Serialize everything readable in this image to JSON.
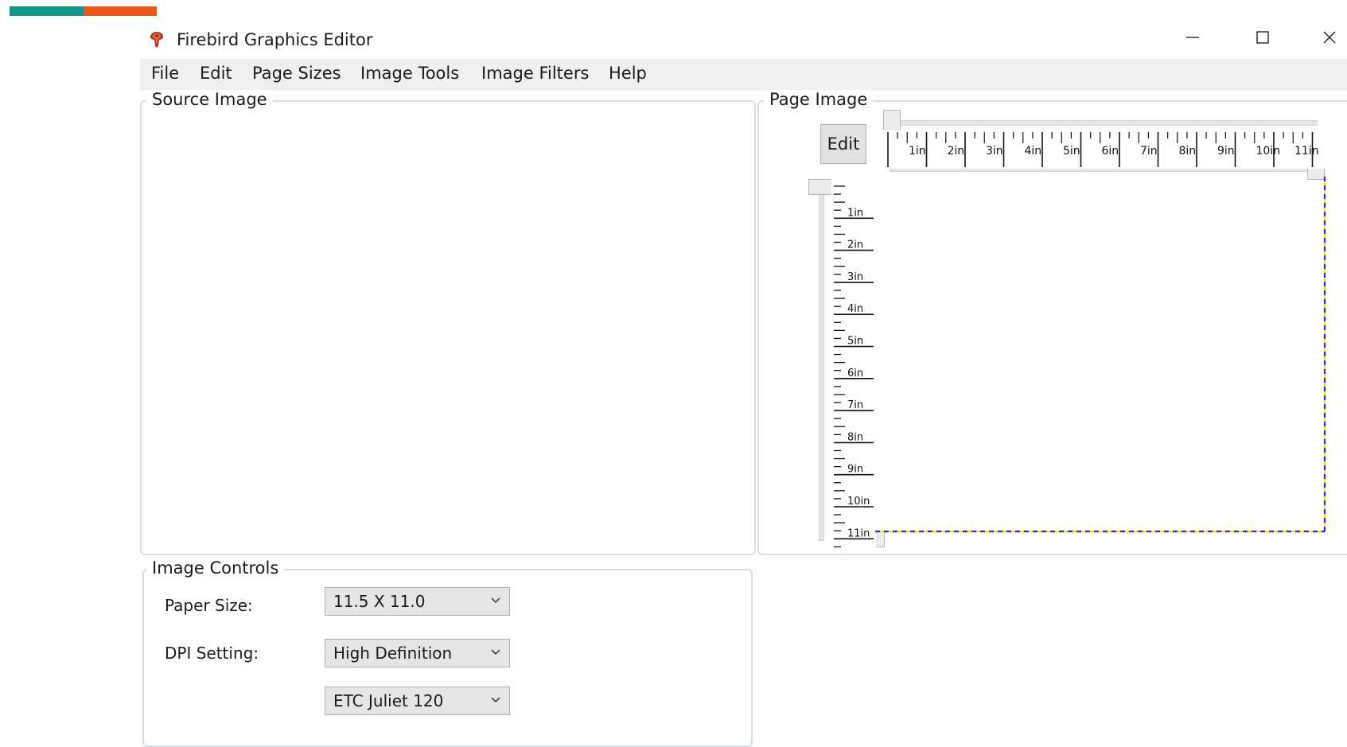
{
  "window": {
    "title": "Firebird Graphics Editor",
    "controls": [
      "minimize",
      "maximize",
      "close"
    ],
    "icon": "firebird-icon"
  },
  "accent_colors": [
    "#16958a",
    "#e8571b"
  ],
  "menu": {
    "items": [
      {
        "label": "File"
      },
      {
        "label": "Edit"
      },
      {
        "label": "Page Sizes"
      },
      {
        "label": "Image Tools"
      },
      {
        "label": "Image Filters"
      },
      {
        "label": "Help"
      }
    ]
  },
  "source_panel": {
    "label": "Source Image"
  },
  "page_panel": {
    "label": "Page Image",
    "edit_button": "Edit",
    "ruler_h_labels": [
      "1in",
      "2in",
      "3in",
      "4in",
      "5in",
      "6in",
      "7in",
      "8in",
      "9in",
      "10in",
      "11in"
    ],
    "ruler_v_labels": [
      "1in",
      "2in",
      "3in",
      "4in",
      "5in",
      "6in",
      "7in",
      "8in",
      "9in",
      "10in",
      "11in"
    ],
    "page_border_colors": [
      "#1f2ee6",
      "#f2e600"
    ]
  },
  "controls_panel": {
    "label": "Image Controls",
    "paper_size": {
      "label": "Paper Size:",
      "value": "11.5 X 11.0"
    },
    "dpi": {
      "label": "DPI Setting:",
      "value": "High Definition"
    },
    "device": {
      "value": "ETC Juliet 120"
    }
  }
}
